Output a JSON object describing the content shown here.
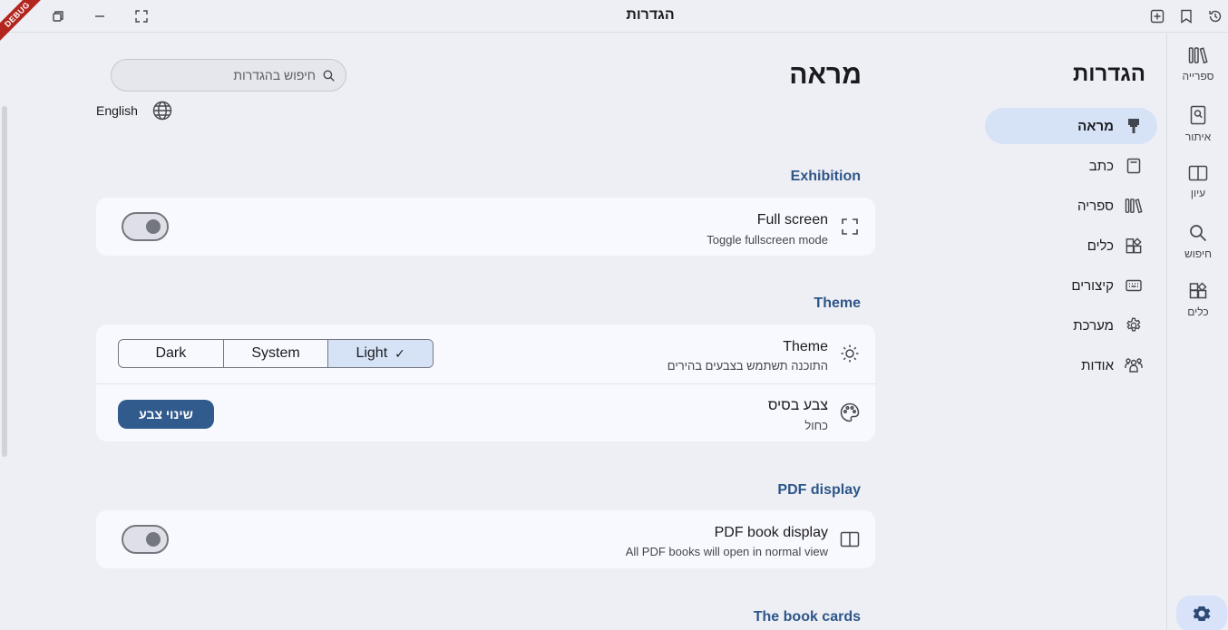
{
  "window": {
    "title": "הגדרות",
    "debug_label": "DEBUG"
  },
  "rail": {
    "items": [
      {
        "label": "ספרייה",
        "icon": "library-icon"
      },
      {
        "label": "איתור",
        "icon": "locate-book-icon"
      },
      {
        "label": "עיון",
        "icon": "book-open-icon"
      },
      {
        "label": "חיפוש",
        "icon": "search-icon"
      },
      {
        "label": "כלים",
        "icon": "tools-icon"
      }
    ],
    "settings_icon": "gear-icon"
  },
  "nav": {
    "title": "הגדרות",
    "items": [
      {
        "label": "מראה",
        "icon": "paint-brush-icon",
        "active": true
      },
      {
        "label": "כתב",
        "icon": "document-icon"
      },
      {
        "label": "ספריה",
        "icon": "library-icon"
      },
      {
        "label": "כלים",
        "icon": "widgets-icon"
      },
      {
        "label": "קיצורים",
        "icon": "keyboard-icon"
      },
      {
        "label": "מערכת",
        "icon": "gear-icon"
      },
      {
        "label": "אודות",
        "icon": "people-icon"
      }
    ]
  },
  "main": {
    "page_title": "מראה",
    "search_placeholder": "חיפוש בהגדרות",
    "language": "English"
  },
  "sections": {
    "exhibition": {
      "heading": "Exhibition",
      "fullscreen_title": "Full screen",
      "fullscreen_sub": "Toggle fullscreen mode",
      "fullscreen_on": false
    },
    "theme": {
      "heading": "Theme",
      "theme_title": "Theme",
      "theme_sub": "התוכנה תשתמש בצבעים בהירים",
      "options": [
        "Dark",
        "System",
        "Light"
      ],
      "selected": "Light",
      "base_color_title": "צבע בסיס",
      "base_color_sub": "כחול",
      "change_color_button": "שינוי צבע"
    },
    "pdf": {
      "heading": "PDF display",
      "pdf_title": "PDF book display",
      "pdf_sub": "All PDF books will open in normal view",
      "pdf_on": false
    },
    "book_cards": {
      "heading": "The book cards"
    }
  },
  "colors": {
    "accent": "#315b8c",
    "heading": "#2e5688",
    "selected_bg": "#d6e3f7",
    "background": "#eeeff5",
    "card": "#f8f9ff"
  }
}
